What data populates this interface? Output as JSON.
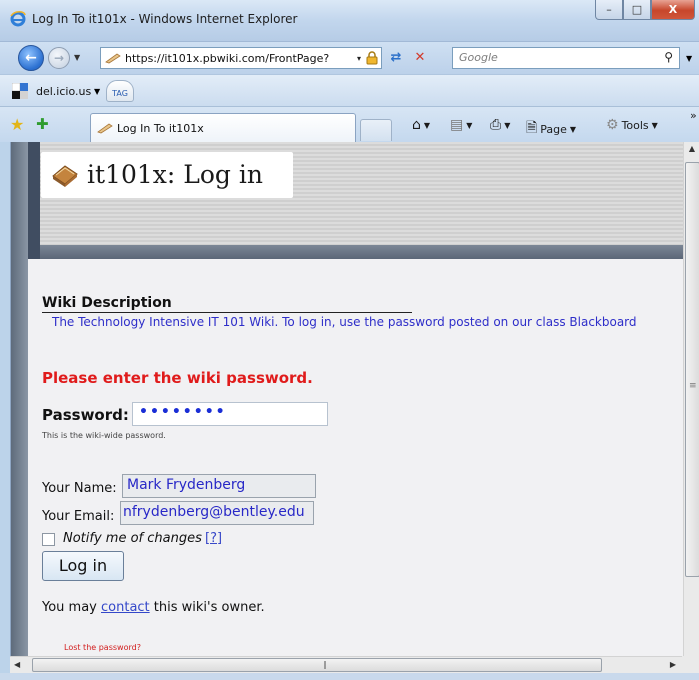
{
  "window": {
    "title": "Log In To it101x - Windows Internet Explorer",
    "controls": {
      "minimize": "–",
      "maximize": "□",
      "close": "X"
    }
  },
  "address_bar": {
    "url": "https://it101x.pbwiki.com/FrontPage?",
    "dropdown": "▾"
  },
  "search": {
    "placeholder": "Google",
    "icon": "search-icon"
  },
  "links_toolbar": {
    "delicious_label": "del.icio.us",
    "tag_label": "TAG"
  },
  "tabs": [
    {
      "label": "Log In To it101x"
    }
  ],
  "command_bar": {
    "page_label": "Page",
    "tools_label": "Tools",
    "overflow": "»"
  },
  "page": {
    "logo_title": "it101x: Log in",
    "wiki_description_title": "Wiki Description",
    "wiki_description_text": "The Technology Intensive IT 101 Wiki. To log in, use the password posted on our class Blackboard",
    "enter_password_prompt": "Please enter the wiki password.",
    "password_label": "Password:",
    "password_value": "••••••••",
    "password_hint": "This is the wiki-wide password.",
    "name_label": "Your Name:",
    "name_value": "Mark Frydenberg",
    "email_label": "Your Email:",
    "email_value": "nfrydenberg@bentley.edu",
    "notify_label": "Notify me of changes",
    "help_link": "[?]",
    "login_button": "Log in",
    "owner_prefix": "You may ",
    "owner_link": "contact",
    "owner_suffix": " this wiki's owner.",
    "lost_password": "Lost the password?"
  },
  "colors": {
    "error_red": "#e01b1b",
    "link_blue": "#3448c9",
    "description_blue": "#2e2ec9",
    "header_dark": "#404d61"
  }
}
